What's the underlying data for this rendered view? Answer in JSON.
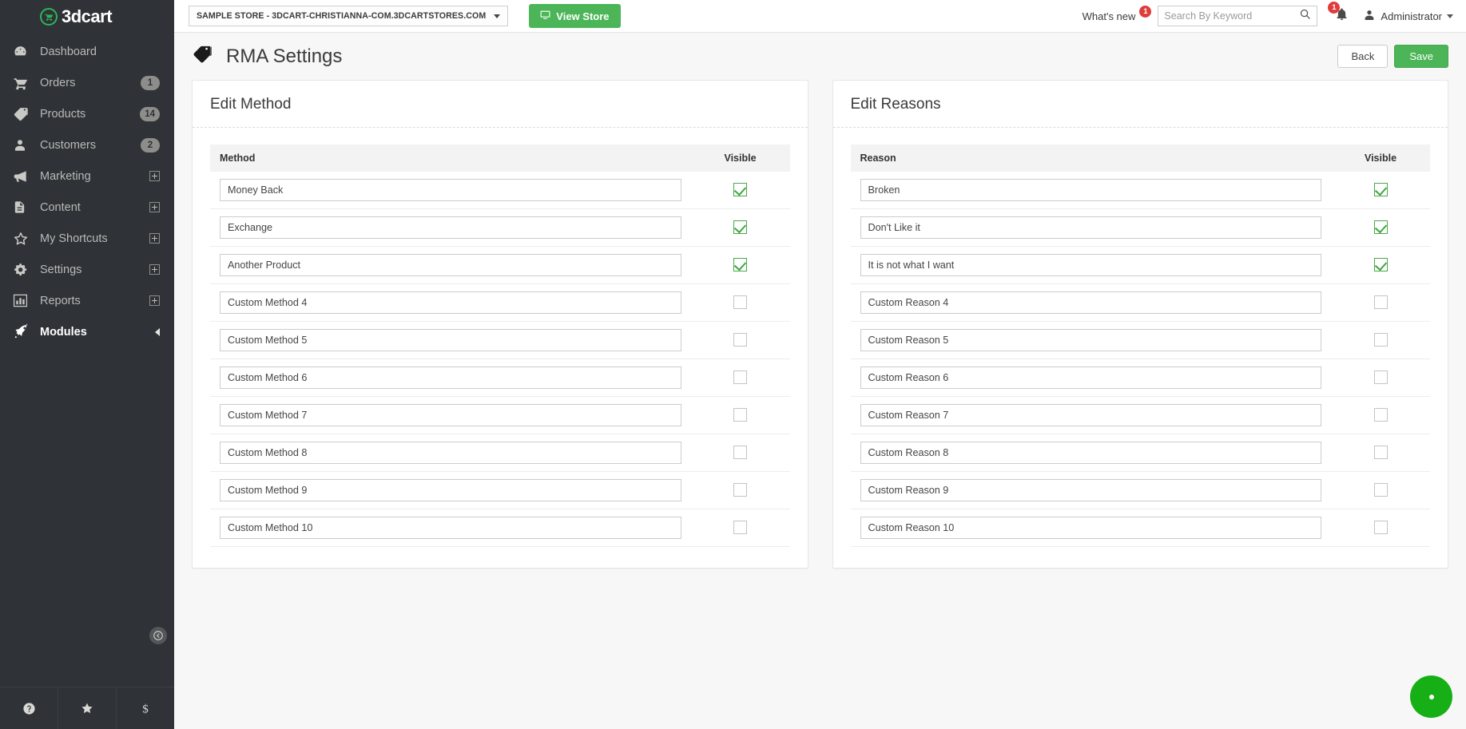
{
  "brand": {
    "name": "3dcart",
    "cart_icon": "shopping-cart-icon"
  },
  "topbar": {
    "store_selector": "SAMPLE STORE - 3DCART-CHRISTIANNA-COM.3DCARTSTORES.COM",
    "view_store_label": "View Store",
    "view_store_icon": "monitor-icon",
    "whats_new_label": "What's new",
    "whats_new_count": "1",
    "search_placeholder": "Search By Keyword",
    "search_value": "",
    "search_icon": "search-icon",
    "notification_icon": "bell-icon",
    "notification_count": "1",
    "user_icon": "user-avatar-icon",
    "user_label": "Administrator"
  },
  "sidebar": {
    "items": [
      {
        "label": "Dashboard",
        "icon": "dashboard-gauge-icon",
        "badge": "",
        "expander": false,
        "active": false
      },
      {
        "label": "Orders",
        "icon": "shopping-cart-icon",
        "badge": "1",
        "expander": false,
        "active": false
      },
      {
        "label": "Products",
        "icon": "tag-icon",
        "badge": "14",
        "expander": false,
        "active": false
      },
      {
        "label": "Customers",
        "icon": "user-icon",
        "badge": "2",
        "expander": false,
        "active": false
      },
      {
        "label": "Marketing",
        "icon": "megaphone-icon",
        "badge": "",
        "expander": true,
        "active": false
      },
      {
        "label": "Content",
        "icon": "document-icon",
        "badge": "",
        "expander": true,
        "active": false
      },
      {
        "label": "My Shortcuts",
        "icon": "star-icon",
        "badge": "",
        "expander": true,
        "active": false
      },
      {
        "label": "Settings",
        "icon": "gears-icon",
        "badge": "",
        "expander": true,
        "active": false
      },
      {
        "label": "Reports",
        "icon": "bar-chart-icon",
        "badge": "",
        "expander": true,
        "active": false
      },
      {
        "label": "Modules",
        "icon": "rocket-icon",
        "badge": "",
        "expander": false,
        "active": true
      }
    ],
    "collapse_icon": "collapse-left-icon",
    "bottom_icons": [
      "help-question-icon",
      "star-icon",
      "dollar-icon"
    ]
  },
  "page": {
    "title": "RMA Settings",
    "title_icon": "tag-icon",
    "back_label": "Back",
    "save_label": "Save"
  },
  "methods_panel": {
    "title": "Edit Method",
    "col_name": "Method",
    "col_visible": "Visible",
    "rows": [
      {
        "value": "Money Back",
        "visible": true
      },
      {
        "value": "Exchange",
        "visible": true
      },
      {
        "value": "Another Product",
        "visible": true
      },
      {
        "value": "Custom Method 4",
        "visible": false
      },
      {
        "value": "Custom Method 5",
        "visible": false
      },
      {
        "value": "Custom Method 6",
        "visible": false
      },
      {
        "value": "Custom Method 7",
        "visible": false
      },
      {
        "value": "Custom Method 8",
        "visible": false
      },
      {
        "value": "Custom Method 9",
        "visible": false
      },
      {
        "value": "Custom Method 10",
        "visible": false
      }
    ]
  },
  "reasons_panel": {
    "title": "Edit Reasons",
    "col_name": "Reason",
    "col_visible": "Visible",
    "rows": [
      {
        "value": "Broken",
        "visible": true
      },
      {
        "value": "Don't Like it",
        "visible": true
      },
      {
        "value": "It is not what I want",
        "visible": true
      },
      {
        "value": "Custom Reason 4",
        "visible": false
      },
      {
        "value": "Custom Reason 5",
        "visible": false
      },
      {
        "value": "Custom Reason 6",
        "visible": false
      },
      {
        "value": "Custom Reason 7",
        "visible": false
      },
      {
        "value": "Custom Reason 8",
        "visible": false
      },
      {
        "value": "Custom Reason 9",
        "visible": false
      },
      {
        "value": "Custom Reason 10",
        "visible": false
      }
    ]
  },
  "fab": {
    "icon": "chat-bubble-icon"
  },
  "colors": {
    "sidebar_bg": "#2f3337",
    "brand_green": "#4cb558",
    "accent_green": "#16b016",
    "badge_red": "#e03c3c",
    "page_bg": "#f7f7f7"
  }
}
